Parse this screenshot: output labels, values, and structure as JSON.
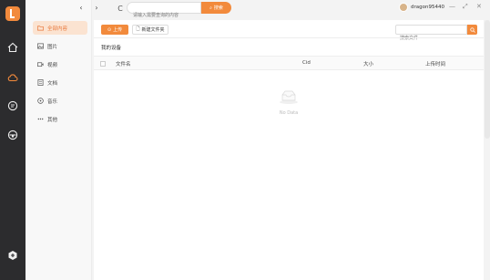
{
  "rail": {
    "icons": [
      "home-icon",
      "cloud-icon",
      "chat-icon",
      "disc-icon",
      "shield-icon"
    ],
    "accent": "#f28a3c"
  },
  "sidebar": {
    "items": [
      {
        "label": "全部内容",
        "icon": "folder-icon",
        "active": true
      },
      {
        "label": "图片",
        "icon": "image-icon",
        "active": false
      },
      {
        "label": "视频",
        "icon": "video-icon",
        "active": false
      },
      {
        "label": "文档",
        "icon": "document-icon",
        "active": false
      },
      {
        "label": "音乐",
        "icon": "music-icon",
        "active": false
      },
      {
        "label": "其他",
        "icon": "more-icon",
        "active": false
      }
    ]
  },
  "topbar": {
    "back": "‹",
    "forward": "›",
    "refresh": "C",
    "search_placeholder": "请输入需要查询的内容",
    "search_button": "搜索",
    "username": "dragon95440",
    "minimize": "—",
    "restore": "⤢",
    "close": "✕"
  },
  "toolbar": {
    "upload_label": "上传",
    "new_folder_label": "新建文件夹",
    "file_search_placeholder": "搜索文件"
  },
  "breadcrumb": "我的设备",
  "table": {
    "columns": [
      "文件名",
      "Cid",
      "大小",
      "上传时间"
    ]
  },
  "empty_state": {
    "text": "No Data"
  }
}
